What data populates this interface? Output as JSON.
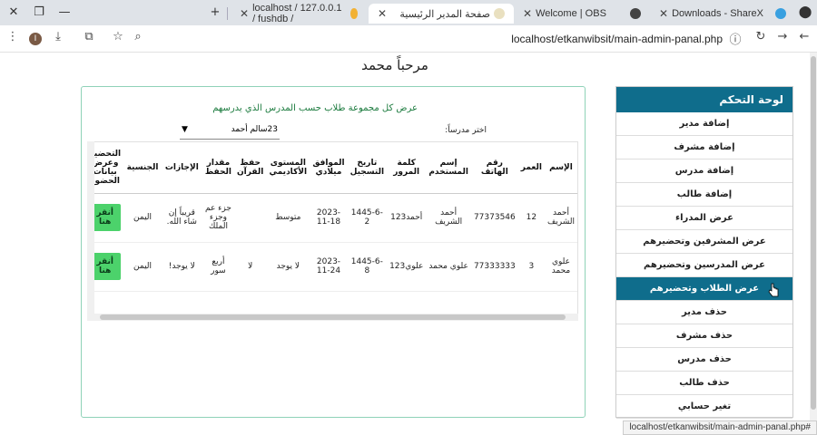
{
  "browser": {
    "tabs": [
      {
        "title": "Downloads - ShareX"
      },
      {
        "title": "Welcome | OBS"
      },
      {
        "title": "صفحة المدير الرئيسية"
      },
      {
        "title": "localhost / 127.0.0.1 / fushdb /"
      }
    ],
    "url": "localhost/etkanwibsit/main-admin-panal.php",
    "avatar_letter": "I",
    "status_url": "localhost/etkanwibsit/main-admin-panal.php#"
  },
  "page": {
    "welcome": "مرحباً محمد",
    "card_title": "عرض كل مجموعة طلاب حسب المدرس الذي يدرسهم",
    "choose_teacher_label": "اختر مدرساً:",
    "teacher_select_value": "23سالم أحمد",
    "table": {
      "headers": [
        "الإسم",
        "العمر",
        "رقم الهاتف",
        "إسم المستخدم",
        "كلمة المرور",
        "تاريخ التسجيل",
        "الموافق ميلادي",
        "المستوى الأكاديمي",
        "حفظ القرآن",
        "مقدار الحفظ",
        "الإجازات",
        "الجنسية",
        "التحضير وعرض بيانات الحضور"
      ],
      "rows": [
        [
          "أحمد الشريف",
          "12",
          "77373546",
          "أحمد الشريف",
          "أحمد123",
          "1445-6-2",
          "2023-11-18",
          "متوسط",
          "",
          "جزء عم وجزء الملك",
          "قريباً إن شاء الله.",
          "اليمن",
          "أنقر هنا"
        ],
        [
          "علوي محمد",
          "3",
          "77333333",
          "علوي محمد",
          "علوي123",
          "1445-6-8",
          "2023-11-24",
          "لا يوجد",
          "لا",
          "أربع سور",
          "لا يوجد!",
          "اليمن",
          "أنقر هنا"
        ]
      ]
    }
  },
  "panel": {
    "title": "لوحة التحكم",
    "items": [
      "إضافة مدير",
      "إضافة مشرف",
      "إضافة مدرس",
      "إضافة طالب",
      "عرض المدراء",
      "عرض المشرفين وتحضيرهم",
      "عرض المدرسين وتحضيرهم",
      "عرض الطلاب وتحضيرهم",
      "حذف مدير",
      "حذف مشرف",
      "حذف مدرس",
      "حذف طالب",
      "تغير حسابي"
    ],
    "active_index": 7
  },
  "colors": {
    "accent": "#0f6d8c",
    "button_green": "#4cd26b",
    "card_border": "#8fd2b8"
  }
}
